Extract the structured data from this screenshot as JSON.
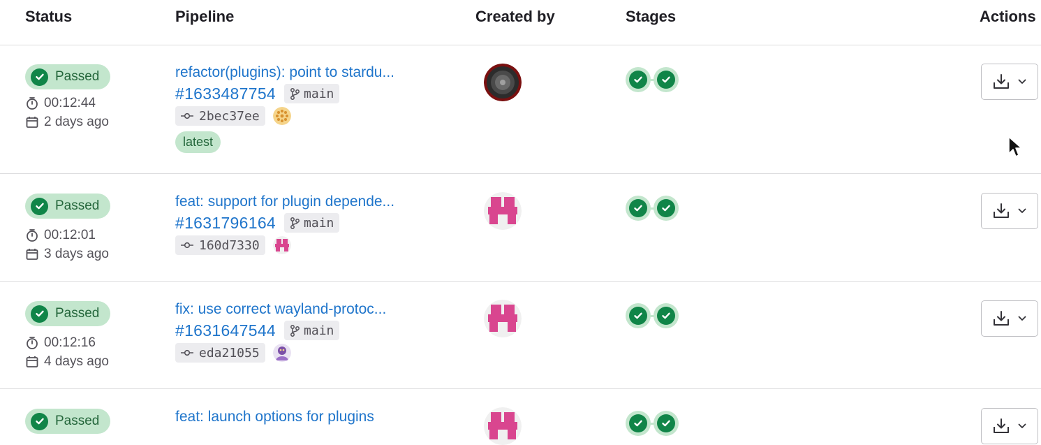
{
  "table": {
    "headers": {
      "status": "Status",
      "pipeline": "Pipeline",
      "created_by": "Created by",
      "stages": "Stages",
      "actions": "Actions"
    },
    "rows": [
      {
        "status": "Passed",
        "duration": "00:12:44",
        "finished": "2 days ago",
        "title": "refactor(plugins): point to stardu...",
        "id": "#1633487754",
        "ref": "main",
        "sha": "2bec37ee",
        "tag": "latest",
        "avatar_icon": "dark-disc-avatar-icon",
        "commit_author_icon": "orange-pattern-avatar-icon",
        "stages": [
          "passed",
          "passed"
        ]
      },
      {
        "status": "Passed",
        "duration": "00:12:01",
        "finished": "3 days ago",
        "title": "feat: support for plugin depende...",
        "id": "#1631796164",
        "ref": "main",
        "sha": "160d7330",
        "avatar_icon": "pink-identicon-avatar-icon",
        "commit_author_icon": "pink-identicon-avatar-icon",
        "stages": [
          "passed",
          "passed"
        ]
      },
      {
        "status": "Passed",
        "duration": "00:12:16",
        "finished": "4 days ago",
        "title": "fix: use correct wayland-protoc...",
        "id": "#1631647544",
        "ref": "main",
        "sha": "eda21055",
        "avatar_icon": "pink-identicon-avatar-icon",
        "commit_author_icon": "purple-character-avatar-icon",
        "stages": [
          "passed",
          "passed"
        ]
      },
      {
        "status": "Passed",
        "title": "feat: launch options for plugins",
        "avatar_icon": "pink-identicon-avatar-icon",
        "stages": [
          "passed",
          "passed"
        ]
      }
    ]
  },
  "colors": {
    "success": "#108548",
    "success_bg": "#c3e6cd",
    "link": "#1f75cb",
    "identicon_pink": "#d9468f"
  }
}
